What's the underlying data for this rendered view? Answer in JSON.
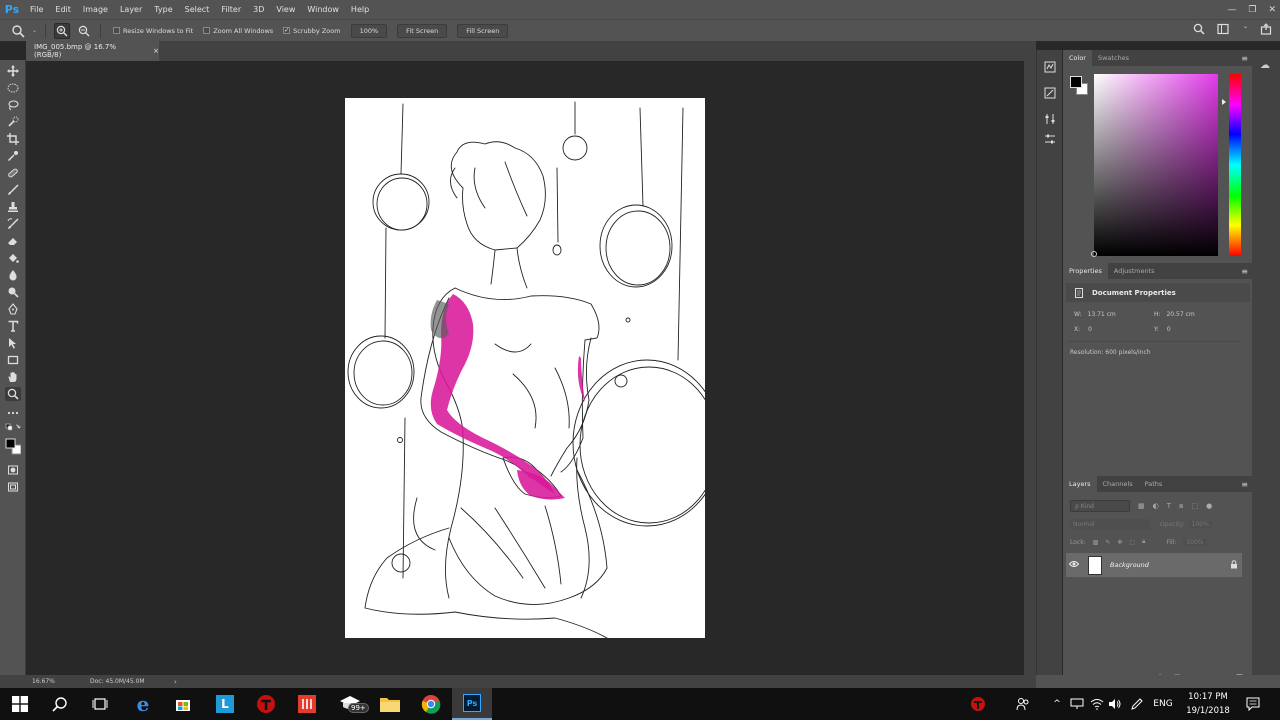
{
  "app": {
    "logo": "Ps",
    "menu": [
      "File",
      "Edit",
      "Image",
      "Layer",
      "Type",
      "Select",
      "Filter",
      "3D",
      "View",
      "Window",
      "Help"
    ]
  },
  "window_controls": {
    "minimize": "—",
    "restore": "❐",
    "close": "✕"
  },
  "options_bar": {
    "resize_windows_label": "Resize Windows to Fit",
    "resize_windows_checked": false,
    "zoom_all_label": "Zoom All Windows",
    "zoom_all_checked": false,
    "scrubby_label": "Scrubby Zoom",
    "scrubby_checked": true,
    "zoom_value": "100%",
    "fit_screen_label": "Fit Screen",
    "fill_screen_label": "Fill Screen"
  },
  "document": {
    "tab_title": "IMG_005.bmp @ 16.7% (RGB/8)",
    "tab_close": "×"
  },
  "status_bar": {
    "zoom": "16.67%",
    "doc_size": "Doc: 45.0M/45.0M",
    "arrow": "›"
  },
  "color_panel": {
    "tabs": [
      "Color",
      "Swatches"
    ],
    "foreground": "#000000",
    "background": "#ffffff",
    "hue_color": "#e23bea"
  },
  "properties_panel": {
    "tabs": [
      "Properties",
      "Adjustments"
    ],
    "section_title": "Document Properties",
    "width_label": "W:",
    "width_value": "13.71 cm",
    "height_label": "H:",
    "height_value": "20.57 cm",
    "x_label": "X:",
    "x_value": "0",
    "y_label": "Y:",
    "y_value": "0",
    "resolution": "Resolution: 600 pixels/inch"
  },
  "layers_panel": {
    "tabs": [
      "Layers",
      "Channels",
      "Paths"
    ],
    "kind_placeholder": "ρ Kind",
    "blend_mode": "Normal",
    "opacity_label": "Opacity:",
    "opacity_value": "100%",
    "lock_label": "Lock:",
    "fill_label": "Fill:",
    "fill_value": "100%",
    "layer_name": "Background"
  },
  "taskbar": {
    "notification_badge": "99+",
    "language": "ENG",
    "time": "10:17 PM",
    "date": "19/1/2018"
  }
}
